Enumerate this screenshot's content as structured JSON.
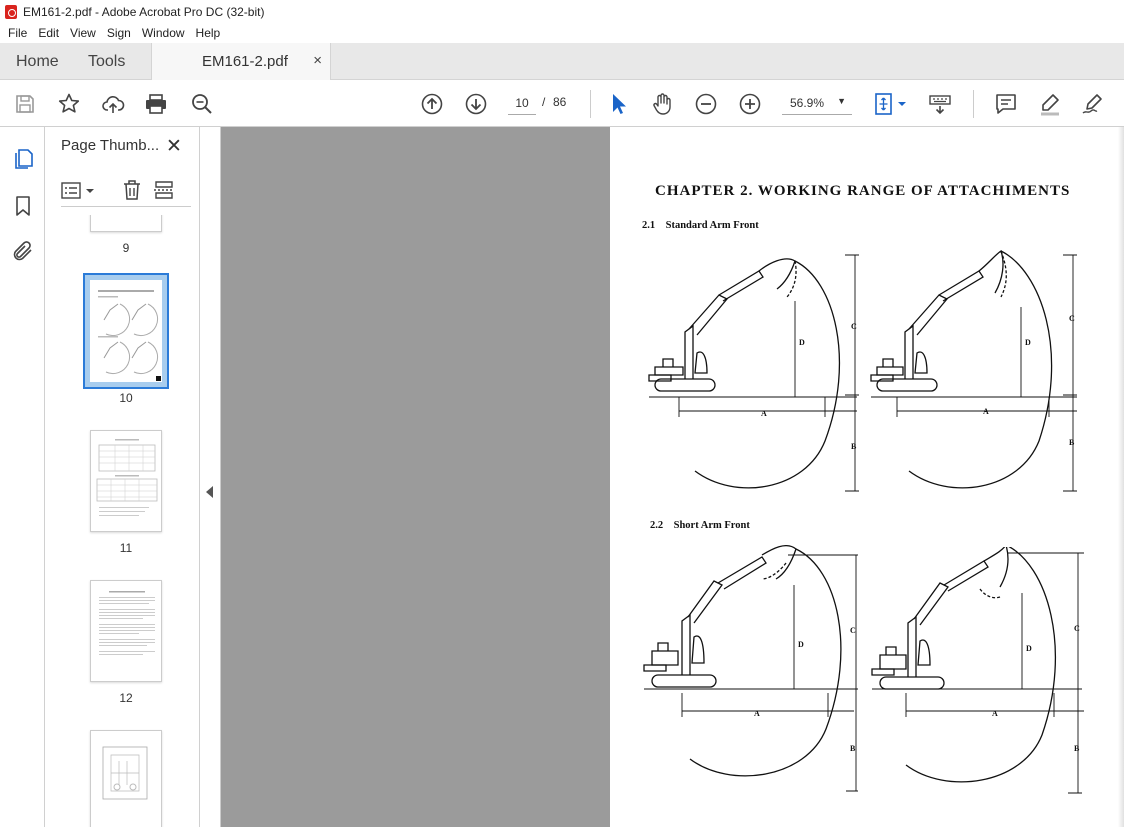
{
  "window": {
    "title": "EM161-2.pdf - Adobe Acrobat Pro DC (32-bit)"
  },
  "menu": [
    "File",
    "Edit",
    "View",
    "Sign",
    "Window",
    "Help"
  ],
  "tabs": {
    "home": "Home",
    "tools": "Tools",
    "document": "EM161-2.pdf",
    "close": "×"
  },
  "toolbar": {
    "page_current": "10",
    "page_separator": "/",
    "page_total": "86",
    "zoom": "56.9%",
    "icons": [
      "save-icon",
      "bookmark-star-icon",
      "cloud-upload-icon",
      "print-icon",
      "zoom-search-icon",
      "prev-page-icon",
      "next-page-icon",
      "select-cursor-icon",
      "hand-tool-icon",
      "zoom-out-icon",
      "zoom-in-icon",
      "page-fit-icon",
      "keyboard-scroll-icon",
      "comment-icon",
      "highlight-icon",
      "sign-icon"
    ]
  },
  "thumbnails": {
    "title": "Page Thumb...",
    "close": "✕",
    "pages": [
      {
        "number": "9"
      },
      {
        "number": "10",
        "selected": true
      },
      {
        "number": "11"
      },
      {
        "number": "12"
      }
    ]
  },
  "document": {
    "chapter_title": "CHAPTER  2. WORKING  RANGE  OF  ATTACHIMENTS",
    "section1": {
      "number": "2.1",
      "title": "Standard Arm Front"
    },
    "section2": {
      "number": "2.2",
      "title": "Short Arm Front"
    },
    "dimension_labels": [
      "A",
      "B",
      "C",
      "D"
    ]
  }
}
